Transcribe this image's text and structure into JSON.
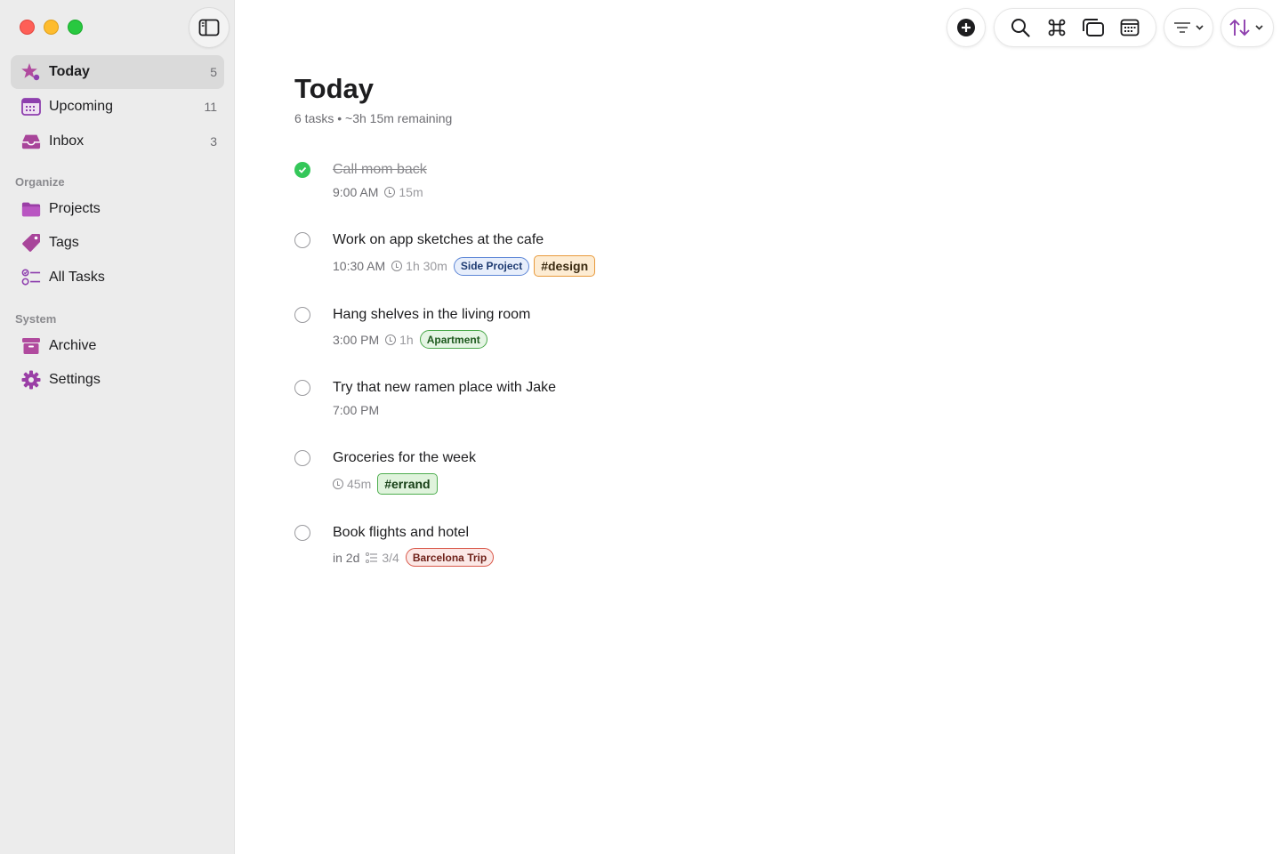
{
  "sidebar": {
    "items": [
      {
        "label": "Today",
        "count": "5"
      },
      {
        "label": "Upcoming",
        "count": "11"
      },
      {
        "label": "Inbox",
        "count": "3"
      }
    ],
    "organize_label": "Organize",
    "organize": [
      {
        "label": "Projects"
      },
      {
        "label": "Tags"
      },
      {
        "label": "All Tasks"
      }
    ],
    "system_label": "System",
    "system": [
      {
        "label": "Archive"
      },
      {
        "label": "Settings"
      }
    ]
  },
  "toolbar": {
    "icons": [
      "add-icon",
      "search-icon",
      "command-icon",
      "windows-icon",
      "calendar-icon",
      "filter-icon",
      "sort-icon"
    ]
  },
  "main": {
    "title": "Today",
    "subtitle": "6 tasks • ~3h 15m remaining",
    "tasks": [
      {
        "title": "Call mom back",
        "done": true,
        "time": "9:00 AM",
        "duration": "15m"
      },
      {
        "title": "Work on app sketches at the cafe",
        "done": false,
        "time": "10:30 AM",
        "duration": "1h 30m",
        "project": "Side Project",
        "tag": "#design"
      },
      {
        "title": "Hang shelves in the living room",
        "done": false,
        "time": "3:00 PM",
        "duration": "1h",
        "project": "Apartment"
      },
      {
        "title": "Try that new ramen place with Jake",
        "done": false,
        "time": "7:00 PM"
      },
      {
        "title": "Groceries for the week",
        "done": false,
        "duration": "45m",
        "tag": "#errand"
      },
      {
        "title": "Book flights and hotel",
        "done": false,
        "due": "in 2d",
        "subtasks": "3/4",
        "project": "Barcelona Trip"
      }
    ]
  },
  "colors": {
    "accent": "#8e3fae",
    "check_done": "#34c759",
    "sidebar_bg": "#ececec"
  }
}
